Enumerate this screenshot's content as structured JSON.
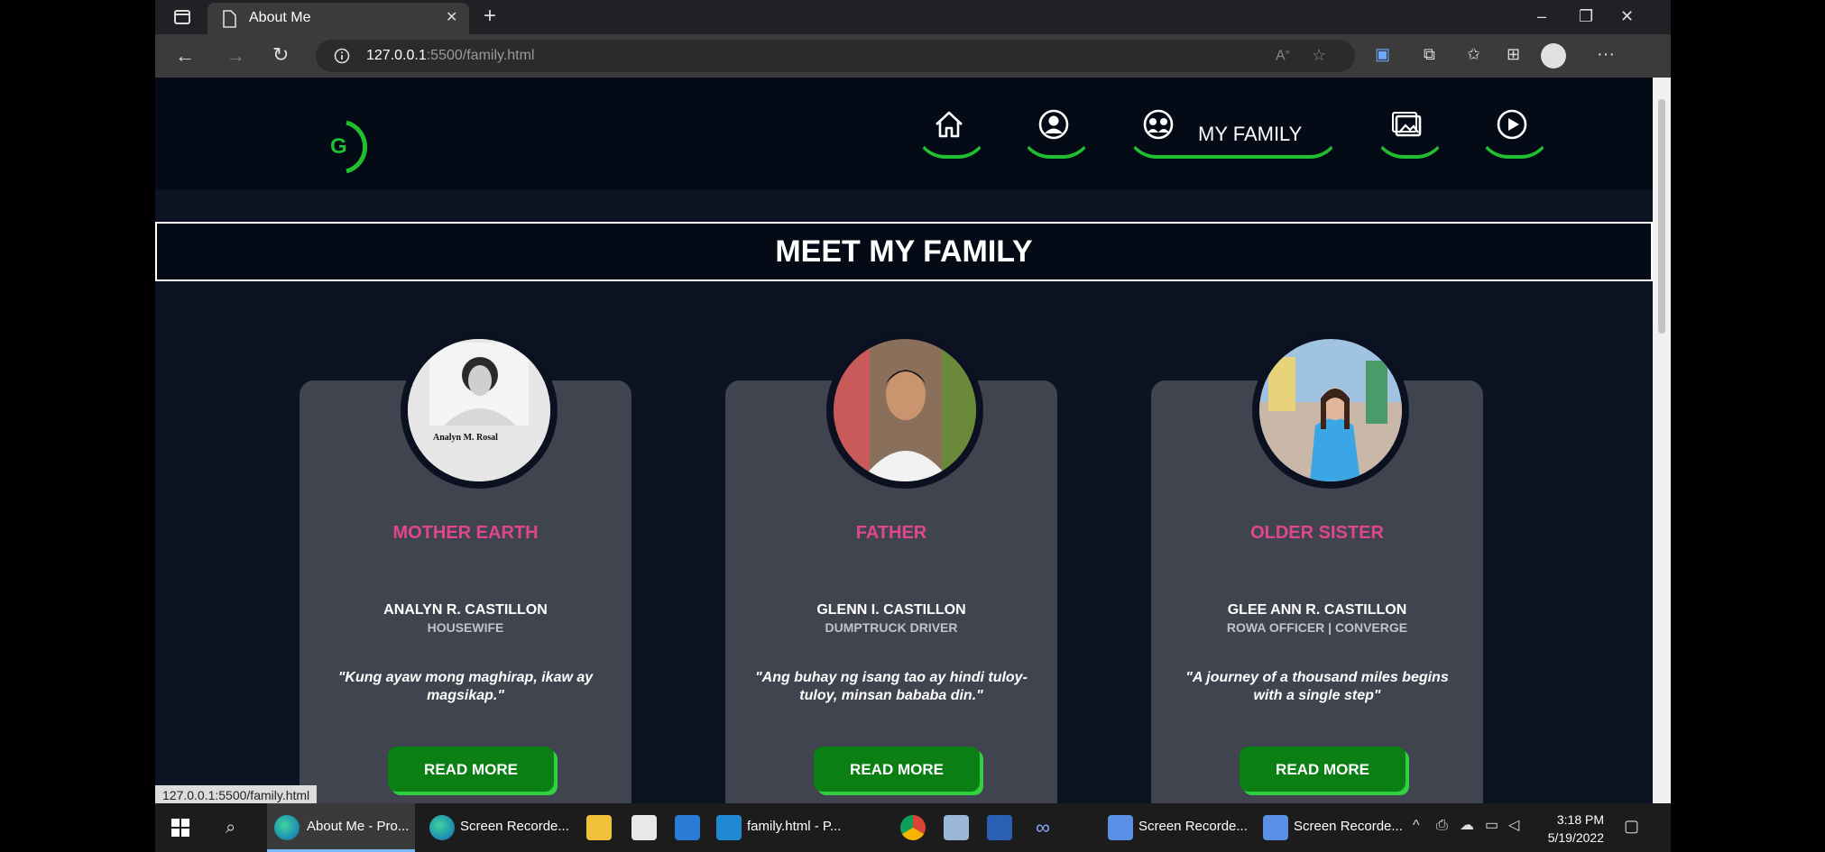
{
  "browser": {
    "tab_title": "About Me",
    "url_host": "127.0.0.1",
    "url_rest": ":5500/family.html",
    "status_url": "127.0.0.1:5500/family.html"
  },
  "nav": {
    "active_label": "MY FAMILY",
    "icons": [
      "home-icon",
      "user-icon",
      "family-icon",
      "gallery-icon",
      "play-icon"
    ],
    "accent": "#1fbf2f"
  },
  "logo": {
    "letter": "G",
    "color": "#1fbf2f"
  },
  "banner": {
    "title": "MEET MY FAMILY"
  },
  "members": [
    {
      "role": "MOTHER EARTH",
      "name": "ANALYN R. CASTILLON",
      "job": "HOUSEWIFE",
      "quote": "\"Kung ayaw mong maghirap, ikaw ay magsikap.\"",
      "photo_caption": "Analyn M. Rosal",
      "button": "READ MORE"
    },
    {
      "role": "FATHER",
      "name": "GLENN I. CASTILLON",
      "job": "DUMPTRUCK DRIVER",
      "quote": "\"Ang buhay ng isang tao ay hindi tuloy-tuloy, minsan bababa din.\"",
      "button": "READ MORE"
    },
    {
      "role": "OLDER SISTER",
      "name": "GLEE ANN R. CASTILLON",
      "job": "ROWA OFFICER | CONVERGE",
      "quote": "\"A journey of a thousand miles begins with a single step\"",
      "button": "READ MORE"
    }
  ],
  "taskbar": {
    "items": [
      "About Me - Pro...",
      "Screen Recorde...",
      "family.html - P...",
      "Screen Recorde...",
      "Screen Recorde..."
    ],
    "time": "3:18 PM",
    "date": "5/19/2022"
  },
  "colors": {
    "role": "#e0478a",
    "button": "#0b7f13",
    "page_bg": "#0c1424"
  }
}
